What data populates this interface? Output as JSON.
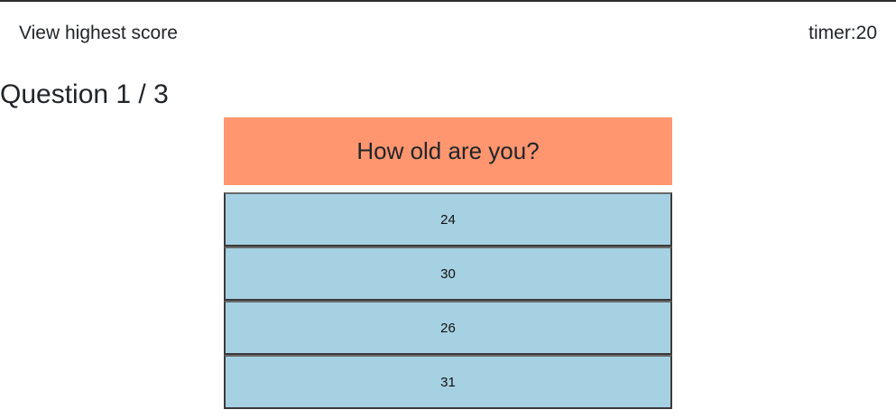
{
  "header": {
    "view_highest_label": "View highest score",
    "timer_text": "timer:20"
  },
  "quiz": {
    "counter_text": "Question 1 / 3",
    "question_text": "How old are you?",
    "answers": [
      "24",
      "30",
      "26",
      "31"
    ]
  },
  "colors": {
    "question_bg": "#ff9670",
    "answer_bg": "#a6d1e2"
  }
}
